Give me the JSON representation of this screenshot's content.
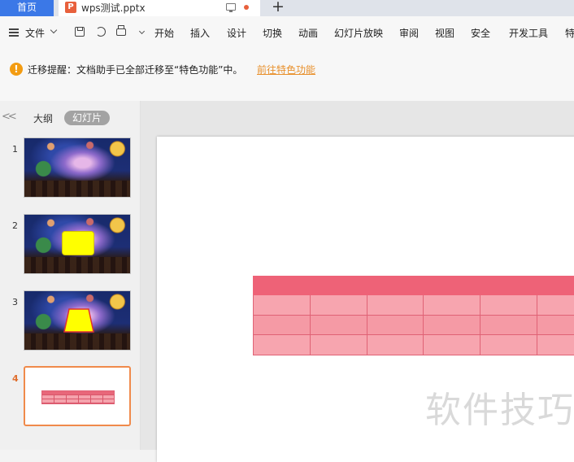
{
  "tabs": {
    "home_label": "首页",
    "doc_icon": "P",
    "doc_title": "wps测试.pptx",
    "add_label": "+"
  },
  "menu": {
    "file_label": "文件",
    "items": [
      "开始",
      "插入",
      "设计",
      "切换",
      "动画",
      "幻灯片放映",
      "审阅",
      "视图",
      "安全",
      "开发工具",
      "特"
    ]
  },
  "notice": {
    "icon": "!",
    "message": "迁移提醒：文档助手已全部迁移至“特色功能”中。",
    "link": "前往特色功能"
  },
  "panel": {
    "collapse": "<<",
    "outline_label": "大纲",
    "slides_label": "幻灯片",
    "thumbnails": [
      {
        "number": "1"
      },
      {
        "number": "2"
      },
      {
        "number": "3"
      },
      {
        "number": "4"
      }
    ]
  },
  "slide": {
    "watermark": "软件技巧"
  },
  "colors": {
    "accent_blue": "#3b78e7",
    "notice_link": "#e8902c",
    "table_header": "#ee6277",
    "table_body": "#f7a5af",
    "active_thumb_border": "#f08a4b"
  }
}
